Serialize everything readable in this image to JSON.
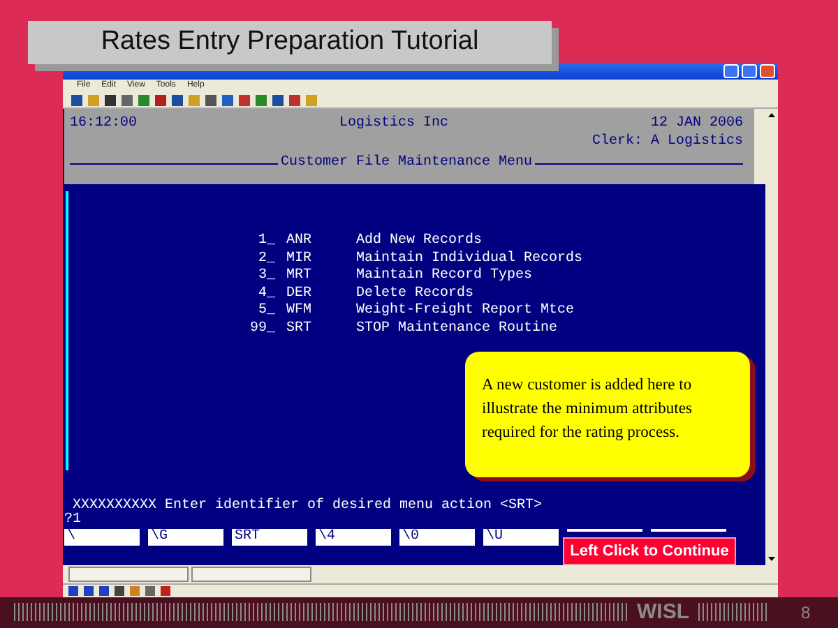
{
  "slide_title": "Rates Entry Preparation Tutorial",
  "app_menu": [
    "File",
    "Edit",
    "View",
    "Tools",
    "Help"
  ],
  "terminal": {
    "time": "16:12:00",
    "company": "Logistics Inc",
    "date": "12 JAN 2006",
    "clerk": "Clerk: A Logistics",
    "menu_title": "Customer File Maintenance Menu",
    "options": [
      {
        "number": "1_",
        "code": "ANR",
        "label": "Add New Records"
      },
      {
        "number": "2_",
        "code": "MIR",
        "label": "Maintain Individual Records"
      },
      {
        "number": "3_",
        "code": "MRT",
        "label": "Maintain Record Types"
      },
      {
        "number": "4_",
        "code": "DER",
        "label": "Delete Records"
      },
      {
        "number": "5_",
        "code": "WFM",
        "label": "Weight-Freight Report Mtce"
      },
      {
        "number": "99_",
        "code": "SRT",
        "label": "STOP Maintenance Routine"
      }
    ],
    "prompt": "XXXXXXXXXX Enter identifier of desired menu action <SRT>",
    "input": "?1",
    "function_keys": [
      "\\",
      "\\G",
      "SRT",
      "\\4",
      "\\0",
      "\\U"
    ]
  },
  "callout": "A new customer is added here to illustrate the minimum attributes required for the rating process.",
  "continue_button": "Left Click to Continue",
  "footer": {
    "brand": "WISL",
    "page": "8"
  }
}
